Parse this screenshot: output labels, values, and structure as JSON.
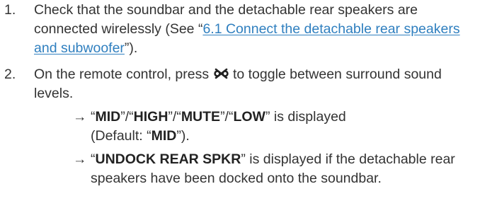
{
  "steps": [
    {
      "number": "1.",
      "text_before_link": "Check that the soundbar and the detachable rear speakers are connected wirelessly (See “",
      "link_text": "6.1 Connect the detachable rear speakers and subwoofer",
      "text_after_link": "”)."
    },
    {
      "number": "2.",
      "text_before_icon": "On the remote control, press ",
      "icon_name": "surround-sound-icon",
      "text_after_icon": " to toggle between surround sound levels.",
      "results": [
        {
          "arrow": "→",
          "parts": [
            {
              "text": "“",
              "bold": false
            },
            {
              "text": "MID",
              "bold": true
            },
            {
              "text": "”/“",
              "bold": false
            },
            {
              "text": "HIGH",
              "bold": true
            },
            {
              "text": "”/“",
              "bold": false
            },
            {
              "text": "MUTE",
              "bold": true
            },
            {
              "text": "”/“",
              "bold": false
            },
            {
              "text": "LOW",
              "bold": true
            },
            {
              "text": "” is displayed",
              "bold": false
            },
            {
              "text": "(Default: “",
              "bold": false,
              "newline": true
            },
            {
              "text": "MID",
              "bold": true
            },
            {
              "text": "”).",
              "bold": false
            }
          ]
        },
        {
          "arrow": "→",
          "parts": [
            {
              "text": "“",
              "bold": false
            },
            {
              "text": "UNDOCK REAR SPKR",
              "bold": true
            },
            {
              "text": "” is displayed if the detachable rear speakers have been docked onto the soundbar.",
              "bold": false
            }
          ]
        }
      ]
    }
  ]
}
